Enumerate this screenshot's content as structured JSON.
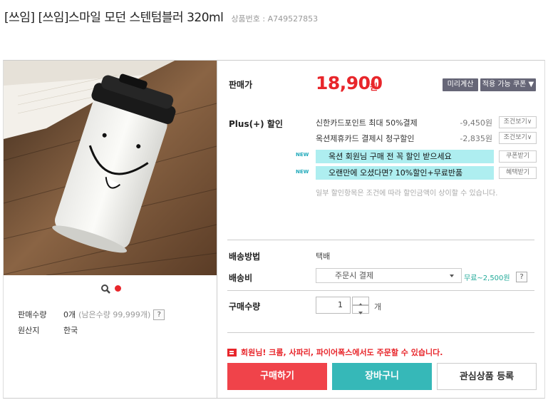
{
  "header": {
    "title": "[쓰임] [쓰임]스마일 모던 스텐텀블러 320ml",
    "product_code": "상품번호 : A749527853"
  },
  "gallery": {
    "zoom_icon": "magnifier-icon",
    "active_dot_color": "#e8262b"
  },
  "product_info": {
    "sold_label": "판매수량",
    "sold_value": "0개",
    "remaining": "(남은수량 99,999개)",
    "help": "?",
    "origin_label": "원산지",
    "origin_value": "한국"
  },
  "price": {
    "label": "판매가",
    "value": "18,900",
    "unit": "원",
    "calc_button": "미리계산",
    "coupon_button": "적용 가능 쿠폰 ▼"
  },
  "discounts": {
    "label": "Plus(+) 할인",
    "rows": [
      {
        "text": "신한카드포인트 최대 50%결제",
        "amount": "-9,450원",
        "button": "조건보기∨"
      },
      {
        "text": "옥션제휴카드 결제시 청구할인",
        "amount": "-2,835원",
        "button": "조건보기∨"
      }
    ],
    "banners": [
      {
        "badge": "NEW",
        "text": "옥션 회원님 구매 전 꼭 할인 받으세요",
        "button": "쿠폰받기"
      },
      {
        "badge": "NEW",
        "text": "오랜만에 오셨다면? 10%할인+무료반품",
        "button": "혜택받기"
      }
    ],
    "note": "일부 할인항목은 조건에 따라 할인금액이 상이할 수 있습니다."
  },
  "shipping": {
    "method_label": "배송방법",
    "method_value": "택배",
    "fee_label": "배송비",
    "fee_select": "주문시 결제",
    "fee_text": "무료~2,500원",
    "help": "?"
  },
  "quantity": {
    "label": "구매수량",
    "value": "1",
    "unit": "개"
  },
  "notice": "회원님! 크롬, 사파리, 파이어폭스에서도 주문할 수 있습니다.",
  "actions": {
    "buy": "구매하기",
    "cart": "장바구니",
    "wish": "관심상품 등록"
  },
  "colors": {
    "accent_red": "#e8262b",
    "teal": "#36b8b8",
    "banner_bg": "#aeeef0"
  }
}
